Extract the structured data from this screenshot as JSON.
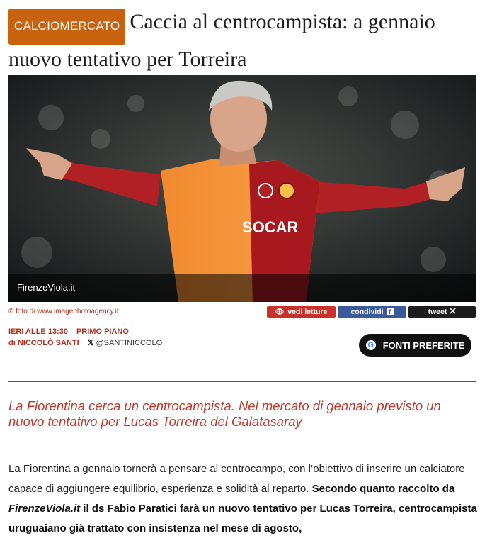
{
  "article": {
    "category": "CALCIOMERCATO",
    "title": "Caccia al centrocampista: a gennaio nuovo tentativo per Torreira",
    "image_credit_overlay": "FirenzeViola.it",
    "photo_credit": "© foto di www.imagephotoagency.it",
    "share": {
      "read_label": "vedi letture",
      "facebook_label": "condividi",
      "tweet_label": "tweet"
    },
    "byline": {
      "time": "IERI ALLE 13:30",
      "section": "PRIMO PIANO",
      "author_prefix": "di",
      "author": "NICCOLÒ SANTI",
      "handle": "@SANTINICCOLO"
    },
    "preferred_sources_label": "FONTI PREFERITE",
    "summary": "La Fiorentina cerca un centrocampista. Nel mercato di gennaio previsto un nuovo tentativo per Lucas Torreira del Galatasaray",
    "body": {
      "p1_plain": "La Fiorentina a gennaio tornerà a pensare al centrocampo, con l’obiettivo di inserire un calciatore capace di aggiungere equilibrio, esperienza e solidità al reparto. ",
      "p1_bold_a": "Secondo quanto raccolto da ",
      "p1_bold_italic": "FirenzeViola.it",
      "p1_bold_b": " il ds Fabio Paratici farà un nuovo tentativo per Lucas Torreira, centrocampista uruguaiano già trattato con insistenza nel mese di agosto,"
    }
  },
  "icons": {
    "eye": "eye-icon",
    "facebook": "facebook-icon",
    "x": "x-logo-icon",
    "google": "google-icon"
  },
  "colors": {
    "badge": "#c8620f",
    "accent_red": "#b0301f",
    "summary_red": "#c0392b",
    "facebook_blue": "#3b5a9c"
  }
}
